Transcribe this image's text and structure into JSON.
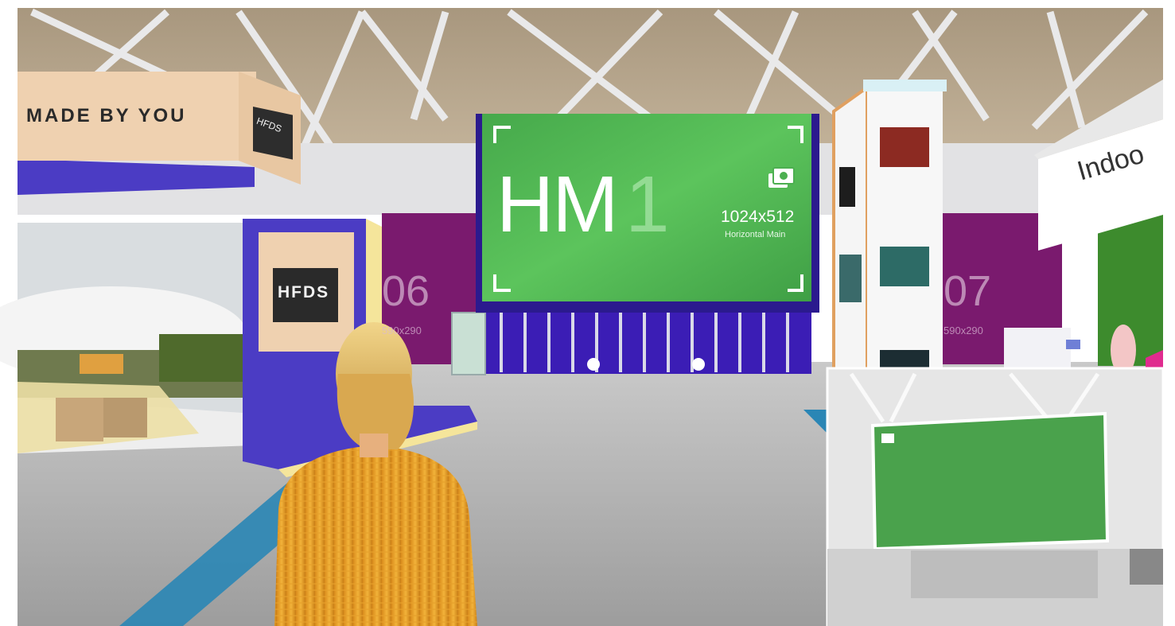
{
  "signs": {
    "made_by_you": "MADE BY YOU",
    "hfds_top": "HFDS",
    "hfds_kiosk": "HFDS",
    "booth_left_num": "06",
    "booth_left_size": "590x290",
    "booth_right_num": "07",
    "booth_right_size": "590x290",
    "indoor_banner": "Indoo"
  },
  "main_screen": {
    "label_letters": "HM",
    "label_number": "1",
    "resolution": "1024x512",
    "subtitle": "Horizontal Main"
  },
  "colors": {
    "screen_green": "#4caf50",
    "booth_purple": "#7a1a6e",
    "frame_blue": "#2b1a8e",
    "ceiling": "#b9a78e",
    "floor": "#b8b8b8"
  }
}
